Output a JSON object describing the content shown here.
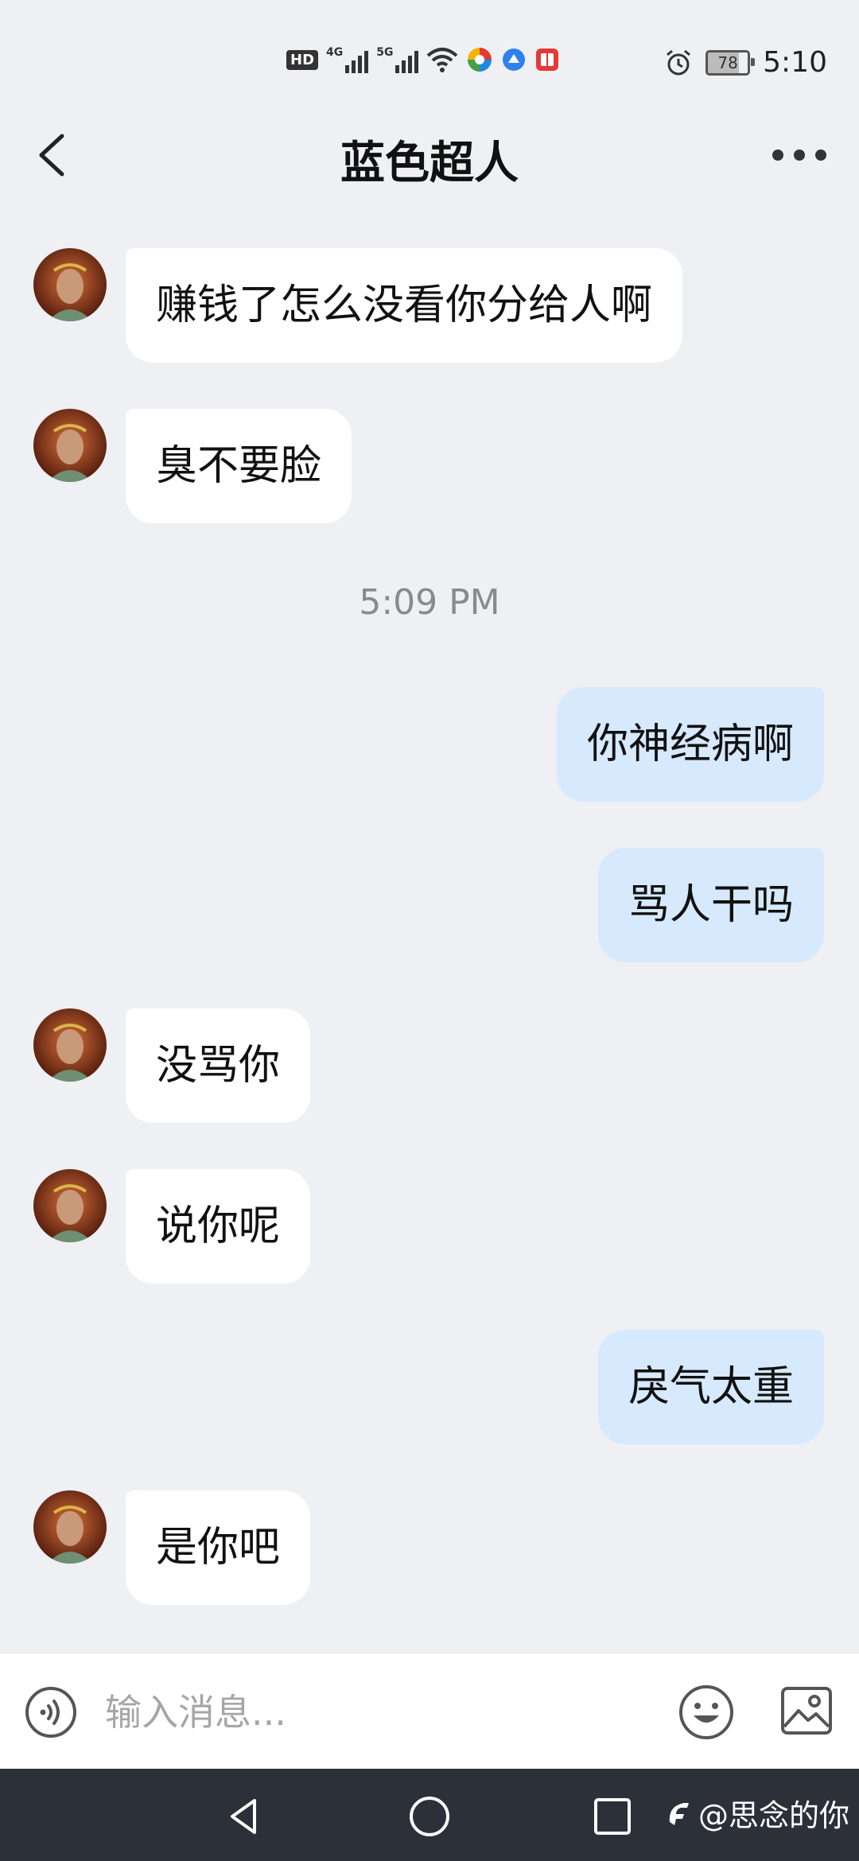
{
  "status_bar": {
    "hd_label": "HD",
    "sim1_label": "4G",
    "sim2_label": "5G",
    "battery_level": "78",
    "time": "5:10"
  },
  "header": {
    "title": "蓝色超人"
  },
  "messages": [
    {
      "side": "left",
      "text": "赚钱了怎么没看你分给人啊"
    },
    {
      "side": "left",
      "text": "臭不要脸"
    },
    {
      "timestamp": "5:09 PM"
    },
    {
      "side": "right",
      "text": "你神经病啊"
    },
    {
      "side": "right",
      "text": "骂人干吗"
    },
    {
      "side": "left",
      "text": "没骂你"
    },
    {
      "side": "left",
      "text": "说你呢"
    },
    {
      "side": "right",
      "text": "戾气太重"
    },
    {
      "side": "left",
      "text": "是你吧"
    }
  ],
  "input": {
    "placeholder": "输入消息..."
  },
  "watermark": {
    "text": "@思念的你"
  },
  "colors": {
    "background": "#eef0f3",
    "incoming_bubble": "#ffffff",
    "outgoing_bubble": "#d7e9fd",
    "nav_bar": "#2c3039"
  }
}
